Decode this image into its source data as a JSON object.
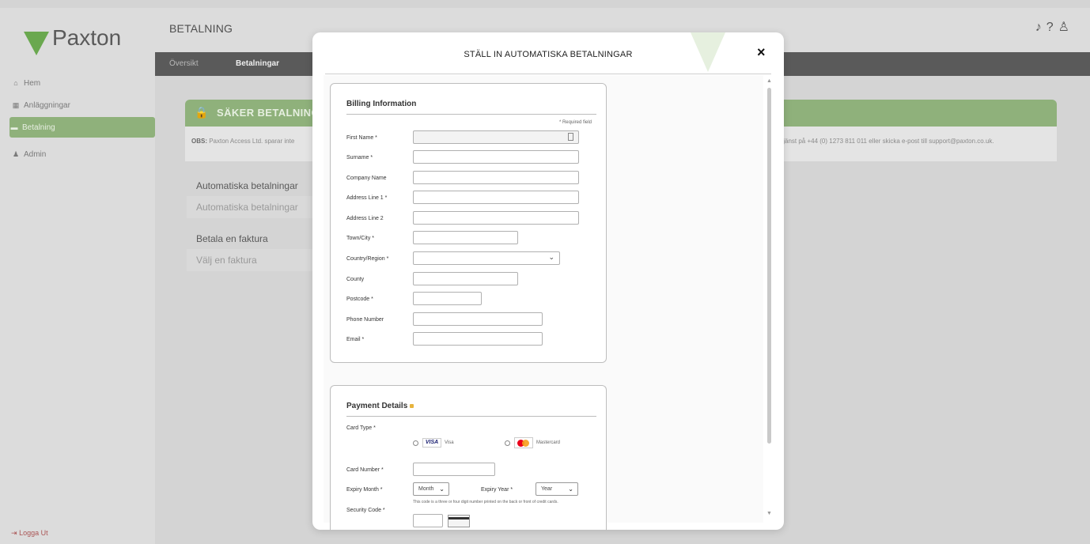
{
  "colors": {
    "brand_green": "#6aa84f",
    "panel_green": "#8fb17b",
    "tabbar": "#5a5a5a"
  },
  "app": {
    "brand": "Paxton",
    "page_heading": "BETALNING",
    "top_icons": {
      "bell": "bell-icon",
      "help": "help-icon",
      "user": "user-icon"
    },
    "sidebar": [
      {
        "label": "Hem",
        "icon": "home-icon"
      },
      {
        "label": "Anläggningar",
        "icon": "building-icon"
      },
      {
        "label": "Betalning",
        "icon": "card-icon"
      },
      {
        "label": "Admin",
        "icon": "admin-icon"
      }
    ],
    "logout": "Logga Ut",
    "tabs": [
      {
        "label": "Översikt"
      },
      {
        "label": "Betalningar"
      }
    ],
    "secure_panel": {
      "title": "SÄKER BETALNING",
      "note_bold": "OBS:",
      "note": " Paxton Access Ltd. sparar inte",
      "contact": "tjänst på +44 (0) 1273 811 011 eller skicka e-post till support@paxton.co.uk."
    },
    "sections": [
      {
        "heading": "Automatiska betalningar",
        "item": "Automatiska betalningar"
      },
      {
        "heading": "Betala en faktura",
        "item": "Välj en faktura"
      }
    ]
  },
  "modal": {
    "title": "STÄLL IN AUTOMATISKA BETALNINGAR",
    "close": "×",
    "billing": {
      "title": "Billing Information",
      "required_note": "* Required field",
      "fields": [
        {
          "label": "First Name *",
          "value": ""
        },
        {
          "label": "Surname *",
          "value": ""
        },
        {
          "label": "Company Name",
          "value": ""
        },
        {
          "label": "Address Line 1 *",
          "value": ""
        },
        {
          "label": "Address Line 2",
          "value": ""
        },
        {
          "label": "Town/City *",
          "value": ""
        },
        {
          "label": "Country/Region *",
          "value": ""
        },
        {
          "label": "County",
          "value": ""
        },
        {
          "label": "Postcode *",
          "value": ""
        },
        {
          "label": "Phone Number",
          "value": ""
        },
        {
          "label": "Email *",
          "value": ""
        }
      ]
    },
    "payment": {
      "title": "Payment Details",
      "card_type_label": "Card Type *",
      "visa_logo": "VISA",
      "visa_label": "Visa",
      "mastercard_label": "Mastercard",
      "card_number_label": "Card Number *",
      "expiry_month_label": "Expiry Month *",
      "expiry_month_value": "Month",
      "expiry_year_label": "Expiry Year *",
      "expiry_year_value": "Year",
      "security_code_label": "Security Code *",
      "security_code_hint": "This code is a three or four digit number printed on the back or front of credit cards."
    }
  }
}
